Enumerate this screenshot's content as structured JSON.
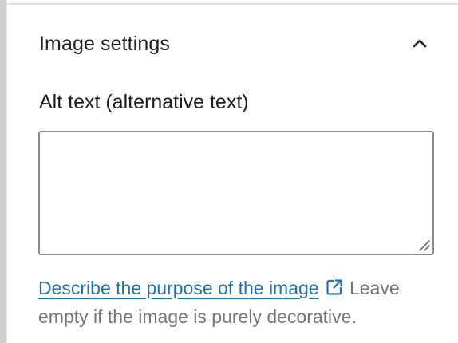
{
  "panel": {
    "title": "Image settings",
    "collapse_icon": "chevron-up-icon"
  },
  "alt_text": {
    "label": "Alt text (alternative text)",
    "value": "",
    "placeholder": ""
  },
  "help": {
    "link_text": "Describe the purpose of the image",
    "link_icon": "external-link-icon",
    "description": "Leave empty if the image is purely decorative."
  },
  "colors": {
    "link": "#2271b1",
    "text": "#1e1e1e",
    "muted": "#757575",
    "border": "#8c8c8c"
  }
}
